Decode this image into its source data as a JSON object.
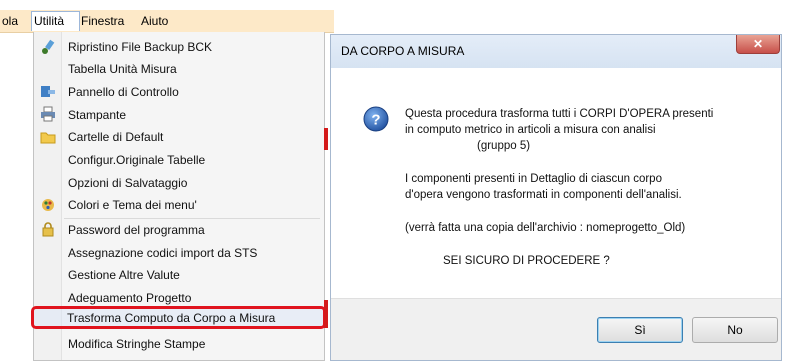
{
  "menubar": {
    "items": [
      "ola",
      "Utilità",
      "Finestra",
      "Aiuto"
    ]
  },
  "menu": {
    "items": [
      {
        "label": "Ripristino File Backup BCK",
        "icon": "restore-icon"
      },
      {
        "label": "Tabella Unità Misura",
        "icon": ""
      },
      {
        "label": "Pannello di Controllo",
        "icon": "control-panel-icon"
      },
      {
        "label": "Stampante",
        "icon": "printer-icon"
      },
      {
        "label": "Cartelle di Default",
        "icon": "folder-icon"
      },
      {
        "label": "Configur.Originale Tabelle",
        "icon": ""
      },
      {
        "label": "Opzioni di Salvataggio",
        "icon": ""
      },
      {
        "label": "Colori e Tema dei menu'",
        "icon": "palette-icon"
      },
      {
        "label": "Password  del programma",
        "icon": "lock-icon"
      },
      {
        "label": "Assegnazione codici import da STS",
        "icon": ""
      },
      {
        "label": "Gestione Altre Valute",
        "icon": ""
      },
      {
        "label": "Adeguamento Progetto",
        "icon": ""
      },
      {
        "label": "Trasforma Computo da Corpo a Misura",
        "icon": "",
        "highlighted": true
      },
      {
        "label": "Modifica Stringhe Stampe",
        "icon": ""
      }
    ]
  },
  "dialog": {
    "title": "DA CORPO A MISURA",
    "close": "✕",
    "icon": "question-icon",
    "lines": [
      "Questa procedura trasforma tutti i CORPI D'OPERA presenti",
      "in computo metrico in articoli a misura con analisi",
      "(gruppo 5)",
      "I componenti presenti in Dettaglio di ciascun corpo",
      "d'opera vengono trasformati in componenti dell'analisi.",
      "(verrà fatta una copia dell'archivio : nomeprogetto_Old)",
      "SEI SICURO DI PROCEDERE ?"
    ],
    "yes_label": "Sì",
    "no_label": "No"
  },
  "colors": {
    "menubar_bg": "#fde9c8",
    "highlight_border": "#e0141e",
    "dialog_title_bg": "#d6e3f2",
    "close_button": "#c7504a",
    "question_icon": "#2b5fb4"
  }
}
